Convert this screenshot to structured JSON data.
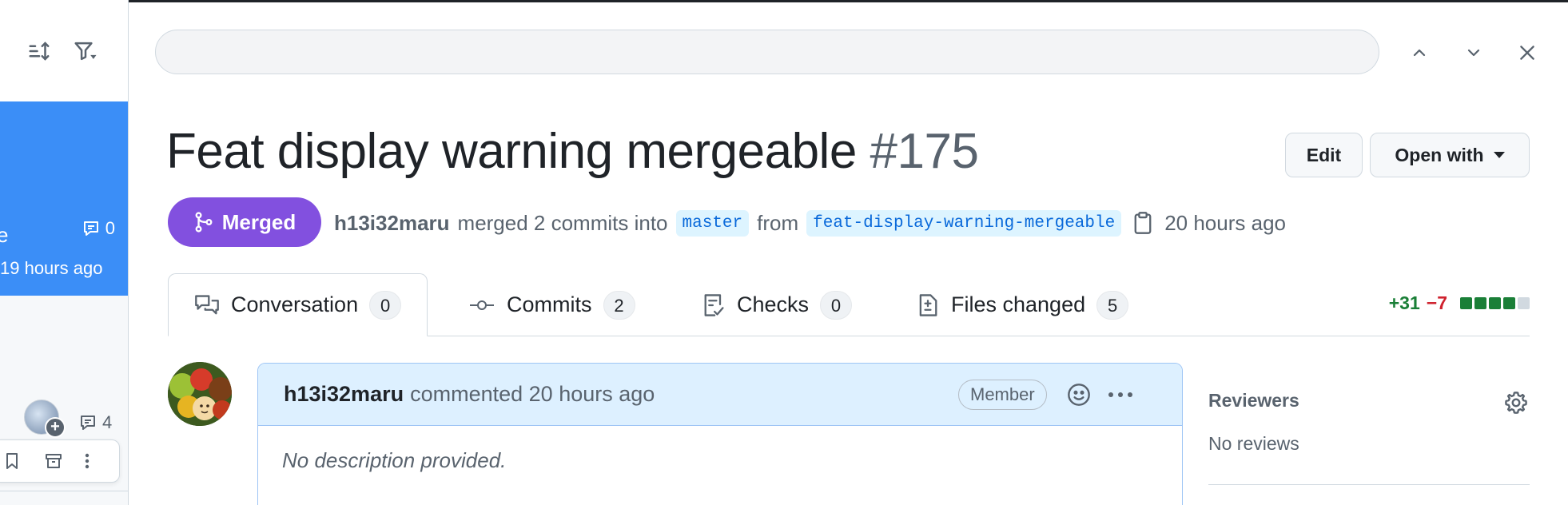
{
  "sidebar": {
    "active_item": {
      "title_fragment": "e",
      "comment_count": "0",
      "time": "19 hours ago"
    },
    "item2": {
      "comment_count": "4"
    }
  },
  "search": {
    "value": "",
    "placeholder": ""
  },
  "pr": {
    "title": "Feat display warning mergeable",
    "number": "#175",
    "edit_label": "Edit",
    "open_with_label": "Open with",
    "state": "Merged",
    "author": "h13i32maru",
    "merged_text": "merged 2 commits into",
    "base_branch": "master",
    "from_text": "from",
    "head_branch": "feat-display-warning-mergeable",
    "time": "20 hours ago"
  },
  "tabs": [
    {
      "label": "Conversation",
      "count": "0"
    },
    {
      "label": "Commits",
      "count": "2"
    },
    {
      "label": "Checks",
      "count": "0"
    },
    {
      "label": "Files changed",
      "count": "5"
    }
  ],
  "diffstat": {
    "additions": "+31",
    "deletions": "−7",
    "blocks": [
      "added",
      "added",
      "added",
      "added",
      "neutral"
    ]
  },
  "comment": {
    "author": "h13i32maru",
    "action": "commented 20 hours ago",
    "role": "Member",
    "body": "No description provided."
  },
  "reviewers": {
    "title": "Reviewers",
    "value": "No reviews"
  },
  "colors": {
    "merged": "#8250df",
    "active_item": "#3b8ef7",
    "added": "#1a7f37",
    "deleted": "#cf222e",
    "neutral": "#d1d9e0"
  }
}
